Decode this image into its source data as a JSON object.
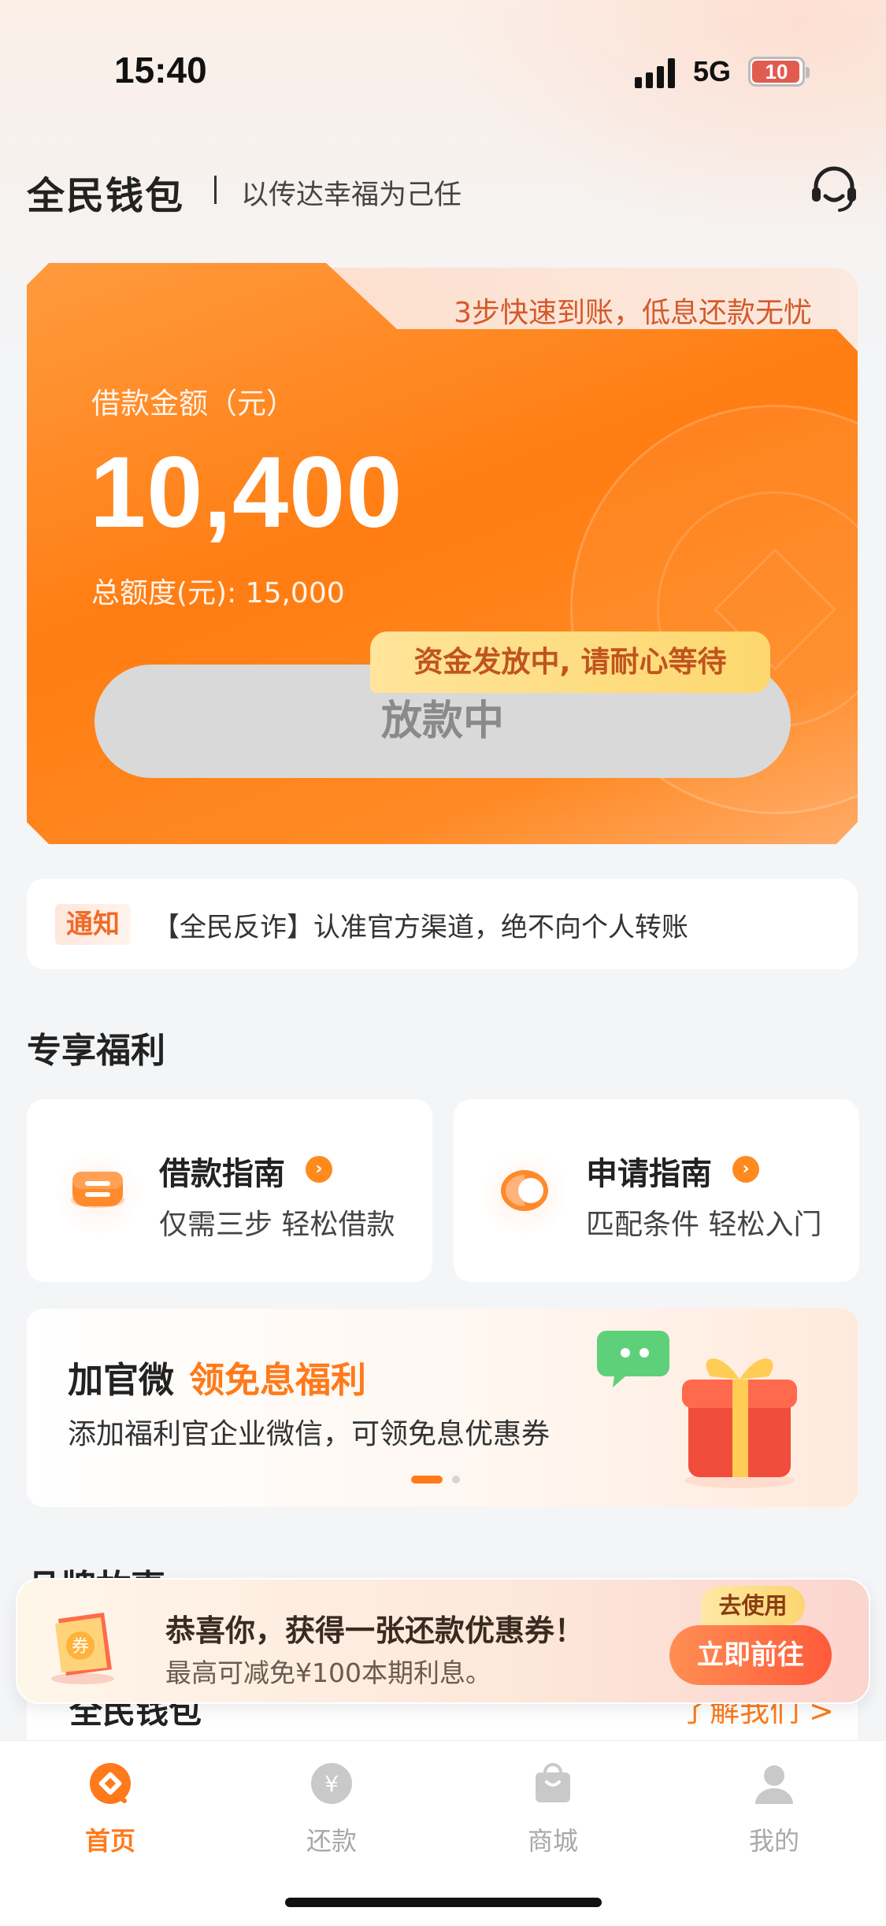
{
  "status_bar": {
    "time": "15:40",
    "network": "5G",
    "battery": "10"
  },
  "header": {
    "logo": "全民钱包",
    "slogan": "以传达幸福为己任",
    "support_icon": "headset-icon"
  },
  "loan_card": {
    "tab_text": "3步快速到账，低息还款无忧",
    "amount_label": "借款金额（元）",
    "amount": "10,400",
    "credit_line": "总额度(元): 15,000",
    "status_button": "放款中",
    "status_tip": "资金发放中, 请耐心等待"
  },
  "notice": {
    "tag": "通知",
    "text": "【全民反诈】认准官方渠道，绝不向个人转账"
  },
  "benefits": {
    "title": "专享福利",
    "cards": [
      {
        "title": "借款指南",
        "desc": "仅需三步  轻松借款",
        "icon": "loan-guide-icon"
      },
      {
        "title": "申请指南",
        "desc": "匹配条件  轻松入门",
        "icon": "compass-icon"
      }
    ]
  },
  "banner": {
    "title_part1": "加官微",
    "title_part2": "领免息福利",
    "desc": "添加福利官企业微信，可领免息优惠券",
    "colors": {
      "accent": "#ff7a1a"
    }
  },
  "brand": {
    "title": "品牌故事",
    "name": "全民钱包",
    "more": "了解我们 >"
  },
  "coupon_toast": {
    "title": "恭喜你，获得一张还款优惠券！",
    "subtitle": "最高可减免¥100本期利息。",
    "button": "立即前往",
    "badge": "去使用",
    "icon": "coupon-icon"
  },
  "tab_bar": {
    "items": [
      {
        "label": "首页",
        "icon": "home-icon",
        "active": true
      },
      {
        "label": "还款",
        "icon": "yen-icon",
        "active": false
      },
      {
        "label": "商城",
        "icon": "shopping-bag-icon",
        "active": false
      },
      {
        "label": "我的",
        "icon": "profile-icon",
        "active": false
      }
    ]
  }
}
